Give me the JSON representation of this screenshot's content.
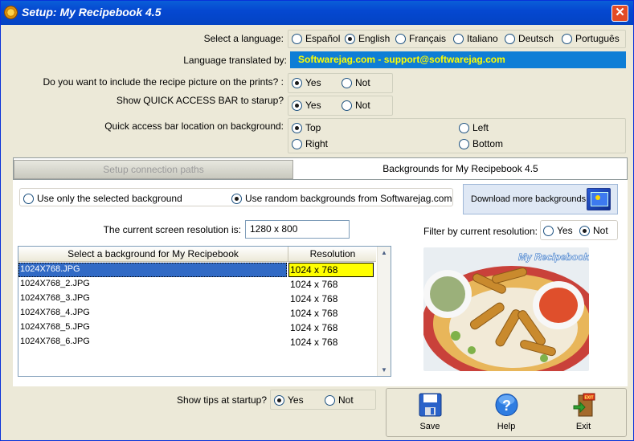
{
  "window": {
    "title": "Setup: My Recipebook 4.5",
    "close_label": "✕"
  },
  "language": {
    "label": "Select a language:",
    "options": [
      "Español",
      "English",
      "Français",
      "Italiano",
      "Deutsch",
      "Português"
    ],
    "selected": "English"
  },
  "translated": {
    "label": "Language translated by:",
    "value": "Softwarejag.com - support@softwarejag.com"
  },
  "picture_on_prints": {
    "label": "Do you want to include the recipe picture on the prints? :",
    "yes": "Yes",
    "no": "Not",
    "selected": "Yes"
  },
  "quick_access": {
    "label": "Show QUICK ACCESS BAR to starup?",
    "yes": "Yes",
    "no": "Not",
    "selected": "Yes"
  },
  "quick_location": {
    "label": "Quick access bar location on background:",
    "options": [
      "Top",
      "Left",
      "Right",
      "Bottom"
    ],
    "selected": "Top"
  },
  "tabs": {
    "inactive": "Setup connection paths",
    "active": "Backgrounds for My Recipebook 4.5"
  },
  "backgrounds": {
    "only_selected": "Use only the selected background",
    "random": "Use random backgrounds from Softwarejag.com",
    "selected_mode": "random",
    "download_label": "Download more backgrounds",
    "resolution_label": "The current screen resolution is:",
    "resolution_value": "1280 x 800",
    "filter_label": "Filter by current resolution:",
    "filter_yes": "Yes",
    "filter_no": "Not",
    "filter_selected": "Not",
    "photo_caption": "My Recipebook"
  },
  "grid": {
    "col1": "Select a background for My Recipebook",
    "col2": "Resolution",
    "rows": [
      {
        "file": "1024X768.JPG",
        "res": "1024 x 768"
      },
      {
        "file": "1024X768_2.JPG",
        "res": "1024 x 768"
      },
      {
        "file": "1024X768_3.JPG",
        "res": "1024 x 768"
      },
      {
        "file": "1024X768_4.JPG",
        "res": "1024 x 768"
      },
      {
        "file": "1024X768_5.JPG",
        "res": "1024 x 768"
      },
      {
        "file": "1024X768_6.JPG",
        "res": "1024 x 768"
      }
    ],
    "selected_row": 0
  },
  "tips": {
    "label": "Show tips at startup?",
    "yes": "Yes",
    "no": "Not",
    "selected": "Yes"
  },
  "actions": {
    "save": "Save",
    "help": "Help",
    "exit": "Exit"
  },
  "colors": {
    "title_bar": "#0548d1",
    "translated_bg": "#0e7ed6",
    "translated_text": "#ffff00",
    "selected_row": "#316ac5",
    "selected_res": "#ffff00"
  }
}
